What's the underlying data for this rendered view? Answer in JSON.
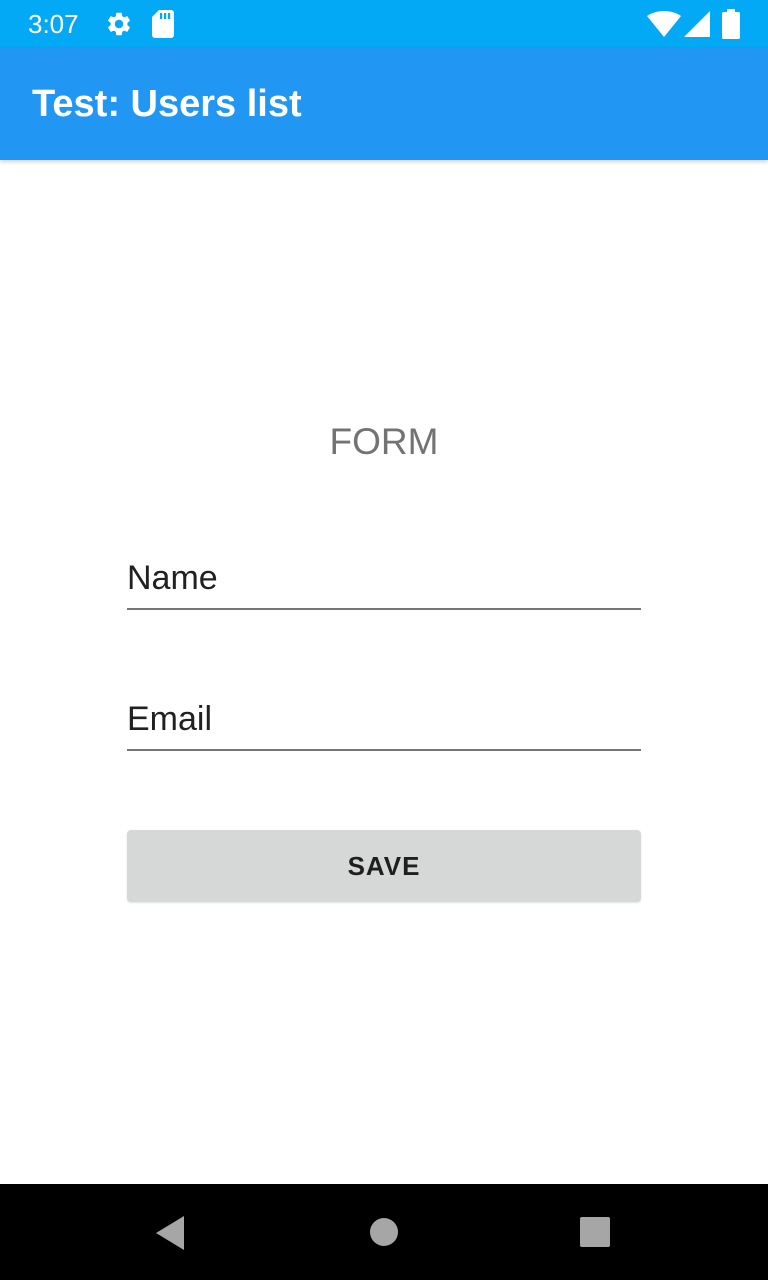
{
  "status_bar": {
    "time": "3:07",
    "icons_left": [
      "gear-icon",
      "sd-card-icon"
    ],
    "icons_right": [
      "wifi-icon",
      "signal-icon",
      "battery-icon"
    ],
    "background": "#03a9f4"
  },
  "app_bar": {
    "title": "Test: Users list",
    "background": "#2196f3"
  },
  "form": {
    "heading": "FORM",
    "name_hint": "Name",
    "email_hint": "Email",
    "save_label": "SAVE"
  },
  "nav_bar": {
    "buttons": [
      "back-icon",
      "home-icon",
      "recents-icon"
    ]
  }
}
